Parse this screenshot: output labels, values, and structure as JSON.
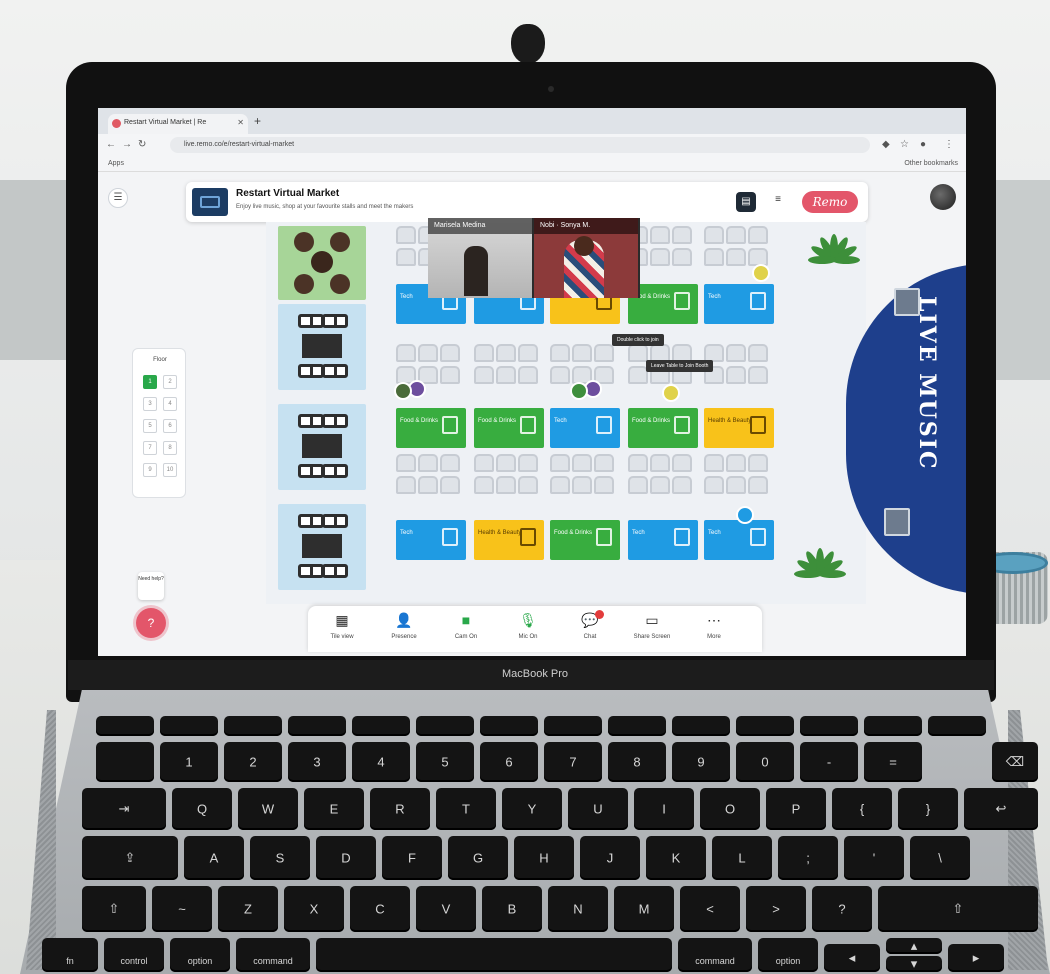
{
  "browser": {
    "tab_title": "Restart Virtual Market | Re",
    "url": "live.remo.co/e/restart-virtual-market",
    "bookmarks_label": "Apps",
    "other_bookmarks": "Other bookmarks"
  },
  "event": {
    "title": "Restart Virtual Market",
    "subtitle": "Enjoy live music, shop at your favourite stalls and meet the makers",
    "remo_logo": "Remo"
  },
  "floor_panel": {
    "title": "Floor",
    "floors": [
      "1",
      "2",
      "3",
      "4",
      "5",
      "6",
      "7",
      "8",
      "9",
      "10"
    ],
    "active_floor": "1"
  },
  "help": {
    "label": "Need help?",
    "icon": "question-icon"
  },
  "videos": [
    {
      "name": "Marisela Medina"
    },
    {
      "name": "Nobi · Sonya M."
    }
  ],
  "booths": {
    "row1": [
      "Tech",
      "Tech",
      "Health & Beauty",
      "Food & Drinks",
      "Tech"
    ],
    "row2": [
      "Food & Drinks",
      "Food & Drinks",
      "Tech",
      "Food & Drinks",
      "Health & Beauty"
    ],
    "row3": [
      "Tech",
      "Health & Beauty",
      "Food & Drinks",
      "Tech",
      "Tech"
    ]
  },
  "tooltips": {
    "a": "Double click to join",
    "b": "Leave Table to Join Booth"
  },
  "stage": {
    "label": "LIVE MUSIC"
  },
  "toolbar": [
    {
      "label": "Tile view",
      "icon": "grid-icon"
    },
    {
      "label": "Presence",
      "icon": "presence-icon"
    },
    {
      "label": "Cam On",
      "icon": "camera-icon"
    },
    {
      "label": "Mic On",
      "icon": "mic-icon"
    },
    {
      "label": "Chat",
      "icon": "chat-icon",
      "badge": "1"
    },
    {
      "label": "Share Screen",
      "icon": "monitor-icon"
    },
    {
      "label": "More",
      "icon": "more-icon"
    }
  ],
  "laptop": {
    "model": "MacBook Pro"
  },
  "keyboard": {
    "row_num": [
      "~`",
      "!1",
      "@2",
      "#3",
      "$4",
      "%5",
      "^6",
      "&7",
      "*8",
      "(9",
      ")0",
      "_-",
      "+="
    ],
    "row_q": [
      "Q",
      "W",
      "E",
      "R",
      "T",
      "Y",
      "U",
      "I",
      "O",
      "P"
    ],
    "row_a": [
      "A",
      "S",
      "D",
      "F",
      "G",
      "H",
      "J",
      "K",
      "L"
    ],
    "row_z": [
      "Z",
      "X",
      "C",
      "V",
      "B",
      "N",
      "M"
    ],
    "fn": "fn",
    "control": "control",
    "option": "option",
    "command": "command",
    "command_r": "command",
    "option_r": "option"
  },
  "colors": {
    "remo_pink": "#e3566a",
    "booth_blue": "#1f9be3",
    "booth_green": "#38ad3f",
    "booth_yellow": "#f8c21a",
    "stage_blue": "#1e3f8c"
  }
}
